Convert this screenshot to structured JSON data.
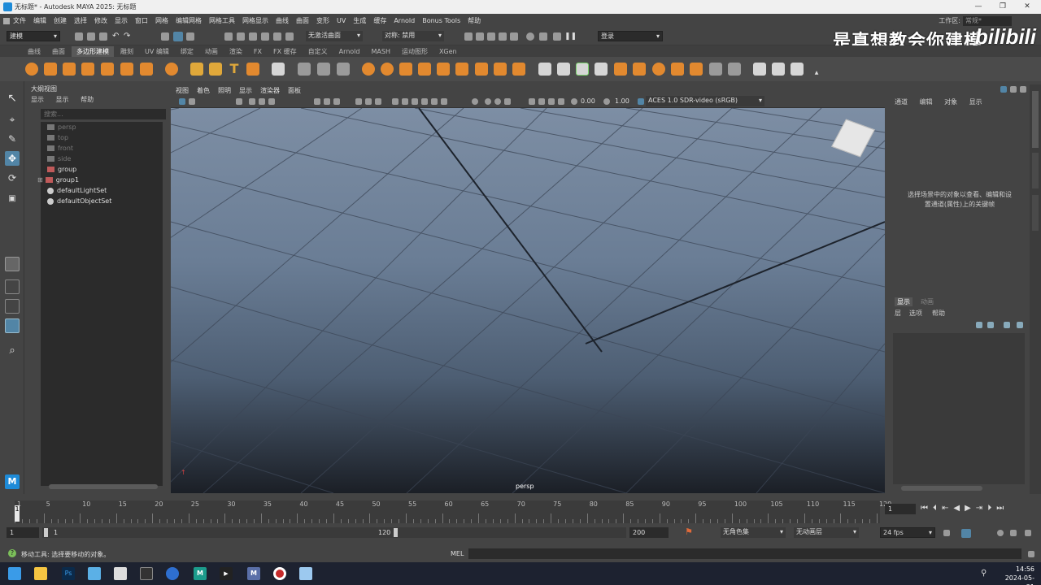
{
  "window": {
    "title": "无标题* - Autodesk MAYA 2025: 无标题",
    "minimize_label": "—",
    "restore_label": "❐",
    "close_label": "✕"
  },
  "menubar": {
    "items": [
      "文件",
      "编辑",
      "创建",
      "选择",
      "修改",
      "显示",
      "窗口",
      "网格",
      "编辑网格",
      "网格工具",
      "网格显示",
      "曲线",
      "曲面",
      "变形",
      "UV",
      "生成",
      "缓存",
      "Arnold",
      "Bonus Tools",
      "帮助"
    ],
    "workspace_label": "工作区:",
    "workspace_value": "常规*"
  },
  "statusline": {
    "mode": "建模",
    "no_live_surface": "无激活曲面",
    "symmetry": "对称: 禁用",
    "login": "登录"
  },
  "shelf": {
    "tabs": [
      "曲线",
      "曲面",
      "多边形建模",
      "雕刻",
      "UV 编辑",
      "绑定",
      "动画",
      "渲染",
      "FX",
      "FX 缓存",
      "自定义",
      "Arnold",
      "MASH",
      "运动图形",
      "XGen"
    ],
    "active_tab": "多边形建模"
  },
  "watermark": {
    "text": "是真想教会你建模",
    "logo": "bilibili"
  },
  "outliner": {
    "title": "大纲视图",
    "menu": [
      "显示",
      "显示",
      "帮助"
    ],
    "search_placeholder": "搜索...",
    "items": [
      {
        "label": "persp",
        "dim": true
      },
      {
        "label": "top",
        "dim": true
      },
      {
        "label": "front",
        "dim": true
      },
      {
        "label": "side",
        "dim": true
      },
      {
        "label": "group",
        "dim": false
      },
      {
        "label": "group1",
        "dim": false
      },
      {
        "label": "defaultLightSet",
        "dim": false
      },
      {
        "label": "defaultObjectSet",
        "dim": false
      }
    ]
  },
  "viewport": {
    "menu": [
      "视图",
      "着色",
      "照明",
      "显示",
      "渲染器",
      "面板"
    ],
    "exposure": "0.00",
    "gamma": "1.00",
    "color_space": "ACES 1.0 SDR-video (sRGB)",
    "camera_label": "persp"
  },
  "channelbox": {
    "menu": [
      "通道",
      "编辑",
      "对象",
      "显示"
    ],
    "hint_line1": "选择场景中的对象以查看、编辑和设",
    "hint_line2": "置通道(属性)上的关键帧"
  },
  "layereditor": {
    "tabs": [
      "显示",
      "动画"
    ],
    "menu": [
      "层",
      "选项",
      "帮助"
    ]
  },
  "timeline": {
    "ticks": [
      "1",
      "5",
      "10",
      "15",
      "20",
      "25",
      "30",
      "35",
      "40",
      "45",
      "50",
      "55",
      "60",
      "65",
      "70",
      "75",
      "80",
      "85",
      "90",
      "95",
      "100",
      "105",
      "110",
      "115",
      "120"
    ],
    "current_frame": "1",
    "range_start_outer": "1",
    "range_start_inner": "1",
    "range_end_inner": "120",
    "range_end_outer": "200",
    "no_character_set": "无角色集",
    "no_anim_layer": "无动画层",
    "fps": "24 fps"
  },
  "commandline": {
    "help_text": "移动工具: 选择要移动的对象。",
    "language": "MEL"
  },
  "taskbar": {
    "time": "14:56",
    "date": "2024-05-21"
  }
}
